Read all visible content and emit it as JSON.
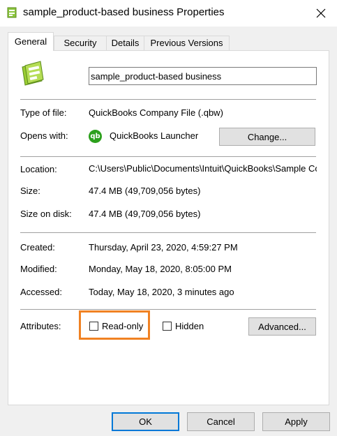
{
  "window": {
    "title": "sample_product-based business Properties",
    "close_icon": "close-icon"
  },
  "tabs": [
    {
      "label": "General",
      "active": true
    },
    {
      "label": "Security",
      "active": false
    },
    {
      "label": "Details",
      "active": false
    },
    {
      "label": "Previous Versions",
      "active": false
    }
  ],
  "file": {
    "name": "sample_product-based business",
    "icon": "quickbooks-file-icon"
  },
  "info": {
    "type_label": "Type of file:",
    "type_value": "QuickBooks Company File (.qbw)",
    "opens_label": "Opens with:",
    "opens_value": "QuickBooks Launcher",
    "opens_icon_text": "qb",
    "change_button": "Change...",
    "location_label": "Location:",
    "location_value": "C:\\Users\\Public\\Documents\\Intuit\\QuickBooks\\Sample Company Files",
    "size_label": "Size:",
    "size_value": "47.4 MB (49,709,056 bytes)",
    "size_disk_label": "Size on disk:",
    "size_disk_value": "47.4 MB (49,709,056 bytes)",
    "created_label": "Created:",
    "created_value": "Thursday, April 23, 2020, 4:59:27 PM",
    "modified_label": "Modified:",
    "modified_value": "Monday, May 18, 2020, 8:05:00 PM",
    "accessed_label": "Accessed:",
    "accessed_value": "Today, May 18, 2020, 3 minutes ago"
  },
  "attributes": {
    "label": "Attributes:",
    "readonly_label": "Read-only",
    "readonly_checked": false,
    "hidden_label": "Hidden",
    "hidden_checked": false,
    "advanced_button": "Advanced...",
    "highlight_color": "#f08223"
  },
  "footer": {
    "ok": "OK",
    "cancel": "Cancel",
    "apply": "Apply"
  }
}
